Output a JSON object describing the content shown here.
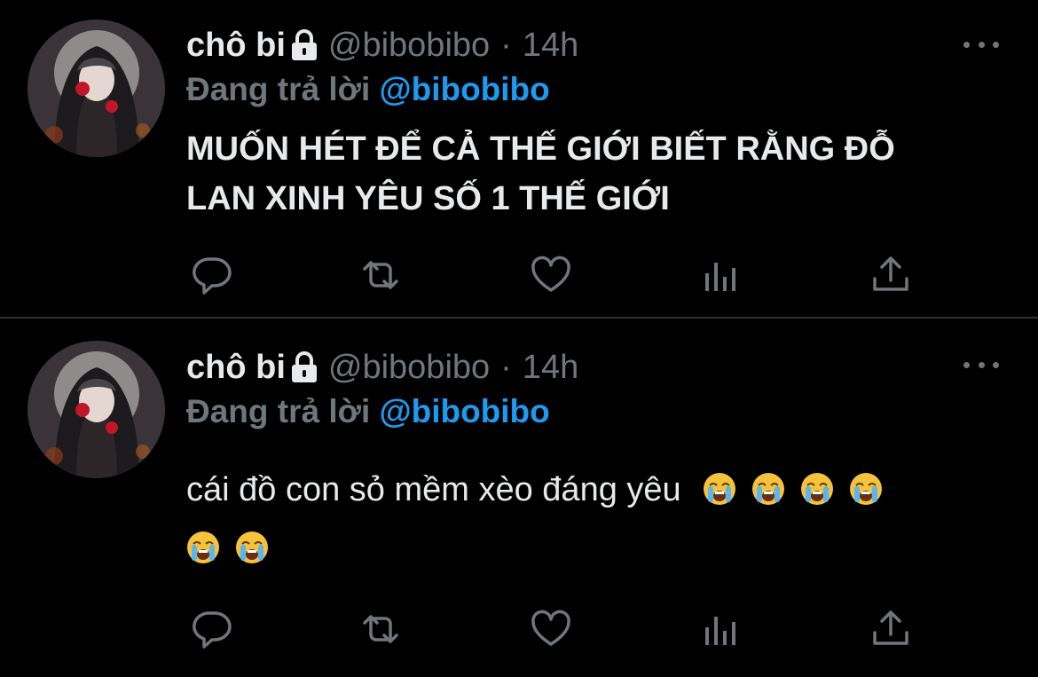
{
  "tweets": [
    {
      "author": {
        "name": "chô bi",
        "handle": "@bibobibo",
        "separator": "·",
        "time": "14h",
        "locked_icon": "lock-icon"
      },
      "replying_label": "Đang trả lời",
      "replying_to": "@bibobibo",
      "text_lines": [
        "MUỐN HÉT ĐỂ CẢ THẾ GIỚI BIẾT RẰNG ĐỖ",
        "LAN XINH YÊU SỐ 1 THẾ GIỚI"
      ],
      "emojis": [],
      "actions": [
        "reply-icon",
        "retweet-icon",
        "like-icon",
        "analytics-icon",
        "share-icon"
      ]
    },
    {
      "author": {
        "name": "chô bi",
        "handle": "@bibobibo",
        "separator": "·",
        "time": "14h",
        "locked_icon": "lock-icon"
      },
      "replying_label": "Đang trả lời",
      "replying_to": "@bibobibo",
      "text_lines": [
        "cái đồ con sỏ mềm xèo đáng yêu"
      ],
      "emojis": [
        "loudly-crying-face",
        "loudly-crying-face",
        "loudly-crying-face",
        "loudly-crying-face",
        "loudly-crying-face",
        "loudly-crying-face"
      ],
      "actions": [
        "reply-icon",
        "retweet-icon",
        "like-icon",
        "analytics-icon",
        "share-icon"
      ]
    }
  ],
  "colors": {
    "background": "#000000",
    "text": "#e7e9ea",
    "muted": "#71767b",
    "accent": "#1d9bf0",
    "divider": "#2f3336"
  }
}
